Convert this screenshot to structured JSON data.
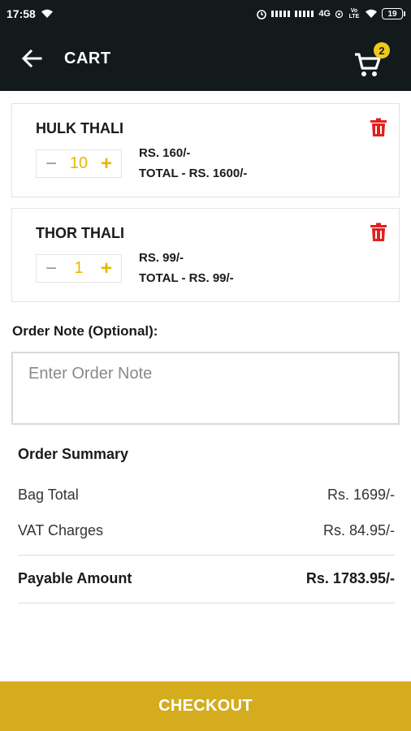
{
  "status_bar": {
    "time": "17:58",
    "network": "4G",
    "volte": "Vo LTE",
    "battery": "19"
  },
  "app_bar": {
    "title": "CART",
    "cart_badge_count": "2"
  },
  "cart_items": [
    {
      "name": "HULK THALI",
      "quantity": "10",
      "price": "RS. 160/-",
      "total": "TOTAL - RS. 1600/-",
      "minus": "−",
      "plus": "+"
    },
    {
      "name": "THOR THALI",
      "quantity": "1",
      "price": "RS. 99/-",
      "total": "TOTAL - RS. 99/-",
      "minus": "−",
      "plus": "+"
    }
  ],
  "order_note": {
    "label": "Order Note (Optional):",
    "placeholder": "Enter Order Note",
    "value": ""
  },
  "summary": {
    "title": "Order Summary",
    "bag_total_label": "Bag Total",
    "bag_total_value": "Rs. 1699/-",
    "vat_label": "VAT Charges",
    "vat_value": "Rs. 84.95/-",
    "payable_label": "Payable Amount",
    "payable_value": "Rs. 1783.95/-"
  },
  "checkout": {
    "label": "CHECKOUT"
  },
  "colors": {
    "app_bar": "#121a1c",
    "accent": "#e6b800",
    "checkout": "#d4ac1e",
    "delete": "#e02020",
    "badge": "#f0c81c"
  },
  "icons": {
    "back": "arrow-left-icon",
    "cart": "shopping-cart-icon",
    "delete": "trash-icon",
    "wifi": "wifi-icon",
    "alarm": "alarm-icon",
    "signal": "signal-icon"
  }
}
